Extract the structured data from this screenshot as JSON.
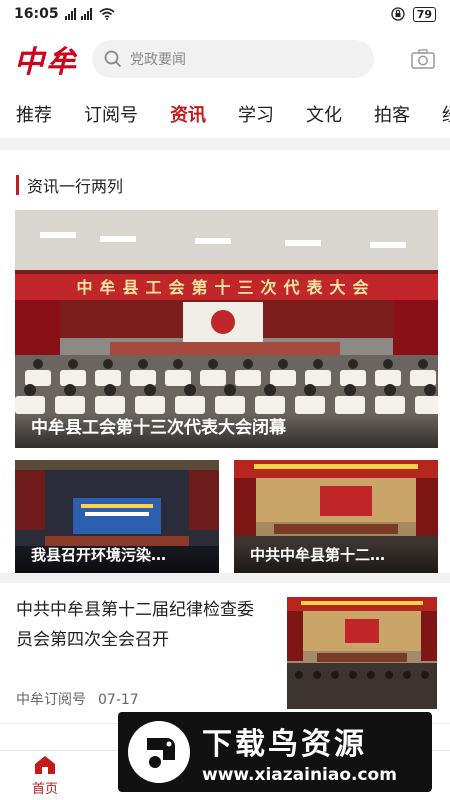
{
  "status": {
    "time": "16:05",
    "battery": "79"
  },
  "header": {
    "logo": "中牟",
    "search_placeholder": "党政要闻"
  },
  "tabs": [
    {
      "label": "推荐"
    },
    {
      "label": "订阅号"
    },
    {
      "label": "资讯",
      "active": true
    },
    {
      "label": "学习"
    },
    {
      "label": "文化"
    },
    {
      "label": "拍客"
    },
    {
      "label": "经济"
    }
  ],
  "section": {
    "title": "资讯一行两列"
  },
  "featured": {
    "banner": "中牟县工会第十三次代表大会",
    "caption": "中牟县工会第十三次代表大会闭幕"
  },
  "grid": [
    {
      "caption": "我县召开环境污染…"
    },
    {
      "caption": "中共中牟县第十二…"
    }
  ],
  "article": {
    "title": "中共中牟县第十二届纪律检查委员会第四次全会召开",
    "source": "中牟订阅号",
    "date": "07-17"
  },
  "bottom_nav": {
    "home": "首页"
  },
  "watermark": {
    "title": "下载鸟资源",
    "url": "www.xiazainiao.com"
  },
  "colors": {
    "accent": "#c41a1a",
    "logo": "#d0021b"
  }
}
